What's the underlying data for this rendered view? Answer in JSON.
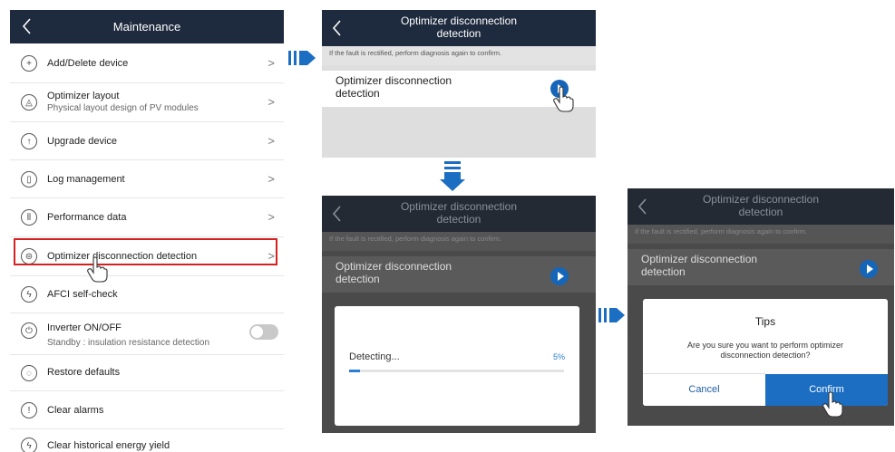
{
  "maintenance": {
    "title": "Maintenance",
    "items": [
      {
        "label": "Add/Delete device",
        "icon": "plus-circle-icon"
      },
      {
        "label": "Optimizer layout",
        "sub": "Physical layout design of PV modules",
        "icon": "layout-icon"
      },
      {
        "label": "Upgrade device",
        "icon": "upgrade-icon"
      },
      {
        "label": "Log management",
        "icon": "log-icon"
      },
      {
        "label": "Performance data",
        "icon": "performance-icon"
      },
      {
        "label": "Optimizer disconnection detection",
        "icon": "optimizer-icon"
      },
      {
        "label": "AFCI self-check",
        "icon": "afci-icon"
      },
      {
        "label": "Inverter ON/OFF",
        "sub": "Standby : insulation resistance detection",
        "icon": "power-icon"
      },
      {
        "label": "Restore defaults",
        "icon": "restore-icon"
      },
      {
        "label": "Clear alarms",
        "icon": "alarm-icon"
      },
      {
        "label": "Clear historical energy yield",
        "icon": "energy-icon"
      }
    ]
  },
  "detection": {
    "title_line1": "Optimizer disconnection",
    "title_line2": "detection",
    "note": "If the fault is rectified, perform diagnosis again to confirm.",
    "row_line1": "Optimizer disconnection",
    "row_line2": "detection"
  },
  "progress": {
    "label": "Detecting...",
    "percent_text": "5%",
    "percent": 5
  },
  "tips": {
    "title": "Tips",
    "message": "Are you sure you want to perform optimizer disconnection detection?",
    "cancel": "Cancel",
    "confirm": "Confirm"
  },
  "colors": {
    "header": "#1e2a3d",
    "accent": "#1b6ec2",
    "highlight": "#d62020"
  }
}
